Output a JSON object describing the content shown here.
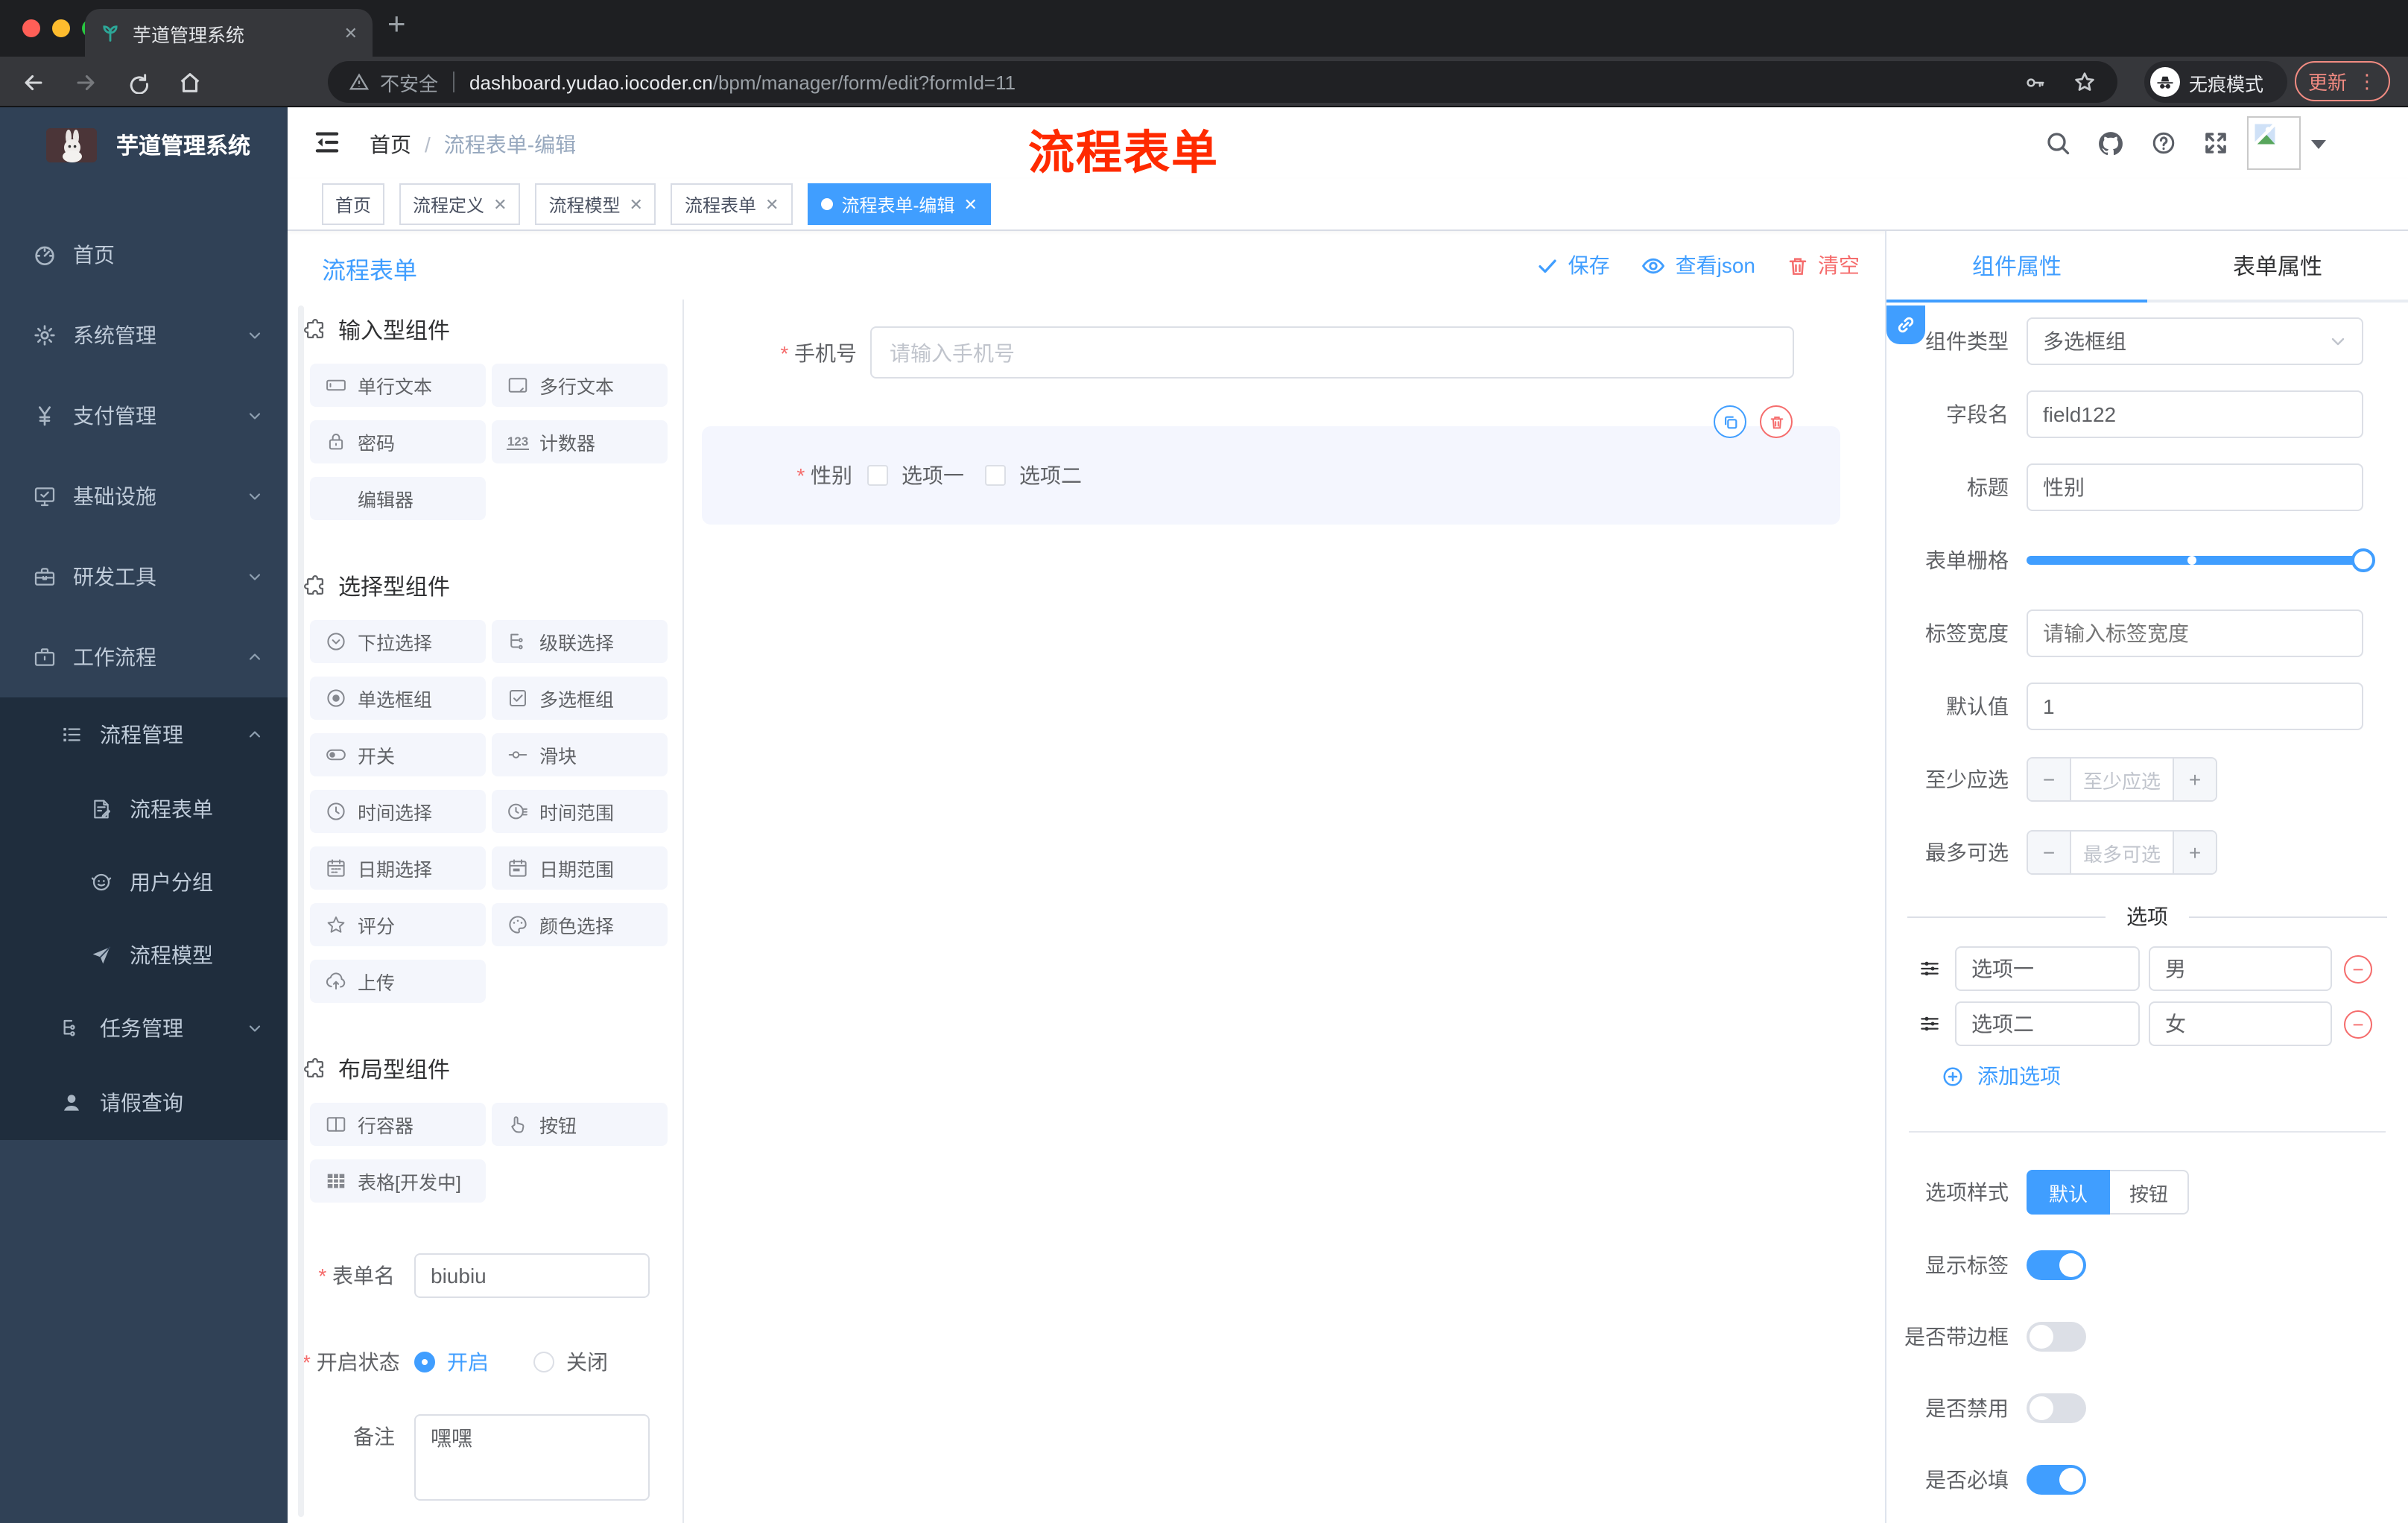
{
  "colors": {
    "accent": "#409eff",
    "danger": "#f56c6c",
    "annotation": "#ff2a00",
    "sidebar_bg": "#304156",
    "submenu_bg": "#1f2d3d"
  },
  "browser": {
    "tab_title": "芋道管理系统",
    "new_tab": "+",
    "close_glyph": "✕",
    "security_label": "不安全",
    "url_host": "dashboard.yudao.iocoder.cn",
    "url_path": "/bpm/manager/form/edit?formId=11",
    "incognito_label": "无痕模式",
    "update_label": "更新"
  },
  "sidebar": {
    "logo_title": "芋道管理系统",
    "items": [
      {
        "icon": "dashboard-icon",
        "label": "首页",
        "level": 1,
        "chevron": null,
        "dark": false
      },
      {
        "icon": "gear-icon",
        "label": "系统管理",
        "level": 1,
        "chevron": "down",
        "dark": false
      },
      {
        "icon": "yen-icon",
        "label": "支付管理",
        "level": 1,
        "chevron": "down",
        "dark": false
      },
      {
        "icon": "monitor-icon",
        "label": "基础设施",
        "level": 1,
        "chevron": "down",
        "dark": false
      },
      {
        "icon": "toolbox-icon",
        "label": "研发工具",
        "level": 1,
        "chevron": "down",
        "dark": false
      },
      {
        "icon": "briefcase-icon",
        "label": "工作流程",
        "level": 1,
        "chevron": "up",
        "dark": false
      },
      {
        "icon": "list-icon",
        "label": "流程管理",
        "level": 2,
        "chevron": "up",
        "dark": true
      },
      {
        "icon": "form-doc-icon",
        "label": "流程表单",
        "level": 3,
        "chevron": null,
        "dark": true
      },
      {
        "icon": "robot-icon",
        "label": "用户分组",
        "level": 3,
        "chevron": null,
        "dark": true
      },
      {
        "icon": "paper-plane-icon",
        "label": "流程模型",
        "level": 3,
        "chevron": null,
        "dark": true
      },
      {
        "icon": "tree-icon",
        "label": "任务管理",
        "level": 2,
        "chevron": "down",
        "dark": true
      },
      {
        "icon": "user-icon",
        "label": "请假查询",
        "level": 2,
        "chevron": null,
        "dark": true
      }
    ]
  },
  "header": {
    "breadcrumb_home": "首页",
    "breadcrumb_sep": "/",
    "breadcrumb_current": "流程表单-编辑",
    "annotation": "流程表单"
  },
  "tags": [
    {
      "label": "首页",
      "closable": false,
      "active": false
    },
    {
      "label": "流程定义",
      "closable": true,
      "active": false
    },
    {
      "label": "流程模型",
      "closable": true,
      "active": false
    },
    {
      "label": "流程表单",
      "closable": true,
      "active": false
    },
    {
      "label": "流程表单-编辑",
      "closable": true,
      "active": true
    }
  ],
  "page_head": {
    "title": "流程表单",
    "save_label": "保存",
    "view_json_label": "查看json",
    "clear_label": "清空"
  },
  "components_panel": {
    "sections": [
      {
        "title": "输入型组件",
        "items": [
          {
            "icon": "input-icon",
            "label": "单行文本"
          },
          {
            "icon": "textarea-icon",
            "label": "多行文本"
          },
          {
            "icon": "lock-icon",
            "label": "密码"
          },
          {
            "icon": "counter-icon",
            "label": "计数器"
          },
          {
            "icon": null,
            "label": "编辑器"
          }
        ]
      },
      {
        "title": "选择型组件",
        "items": [
          {
            "icon": "select-icon",
            "label": "下拉选择"
          },
          {
            "icon": "cascader-icon",
            "label": "级联选择"
          },
          {
            "icon": "radio-icon",
            "label": "单选框组"
          },
          {
            "icon": "checkbox-icon",
            "label": "多选框组"
          },
          {
            "icon": "switch-icon",
            "label": "开关"
          },
          {
            "icon": "slider-icon",
            "label": "滑块"
          },
          {
            "icon": "time-icon",
            "label": "时间选择"
          },
          {
            "icon": "time-range-icon",
            "label": "时间范围"
          },
          {
            "icon": "date-icon",
            "label": "日期选择"
          },
          {
            "icon": "date-range-icon",
            "label": "日期范围"
          },
          {
            "icon": "star-icon",
            "label": "评分"
          },
          {
            "icon": "palette-icon",
            "label": "颜色选择"
          },
          {
            "icon": "upload-icon",
            "label": "上传"
          }
        ]
      },
      {
        "title": "布局型组件",
        "items": [
          {
            "icon": "row-icon",
            "label": "行容器"
          },
          {
            "icon": "button-icon",
            "label": "按钮"
          },
          {
            "icon": "table-icon",
            "label": "表格[开发中]"
          }
        ]
      }
    ]
  },
  "form_settings": {
    "name_label": "表单名",
    "name_value": "biubiu",
    "status_label": "开启状态",
    "status_on": "开启",
    "status_off": "关闭",
    "status_selected": "开启",
    "remark_label": "备注",
    "remark_value": "嘿嘿"
  },
  "canvas": {
    "phone_label": "手机号",
    "phone_placeholder": "请输入手机号",
    "gender_label": "性别",
    "gender_options": [
      "选项一",
      "选项二"
    ]
  },
  "props": {
    "tabs": [
      "组件属性",
      "表单属性"
    ],
    "active_tab": "组件属性",
    "component_type_label": "组件类型",
    "component_type_value": "多选框组",
    "field_name_label": "字段名",
    "field_name_value": "field122",
    "title_label": "标题",
    "title_value": "性别",
    "grid_label": "表单栅格",
    "label_width_label": "标签宽度",
    "label_width_placeholder": "请输入标签宽度",
    "default_label": "默认值",
    "default_value": "1",
    "min_label": "至少应选",
    "min_placeholder": "至少应选",
    "max_label": "最多可选",
    "max_placeholder": "最多可选",
    "options_divider": "选项",
    "options": [
      {
        "label": "选项一",
        "value": "男"
      },
      {
        "label": "选项二",
        "value": "女"
      }
    ],
    "add_option_label": "添加选项",
    "style_label": "选项样式",
    "style_options": [
      "默认",
      "按钮"
    ],
    "style_selected": "默认",
    "switches": [
      {
        "label": "显示标签",
        "on": true
      },
      {
        "label": "是否带边框",
        "on": false
      },
      {
        "label": "是否禁用",
        "on": false
      },
      {
        "label": "是否必填",
        "on": true
      }
    ]
  }
}
